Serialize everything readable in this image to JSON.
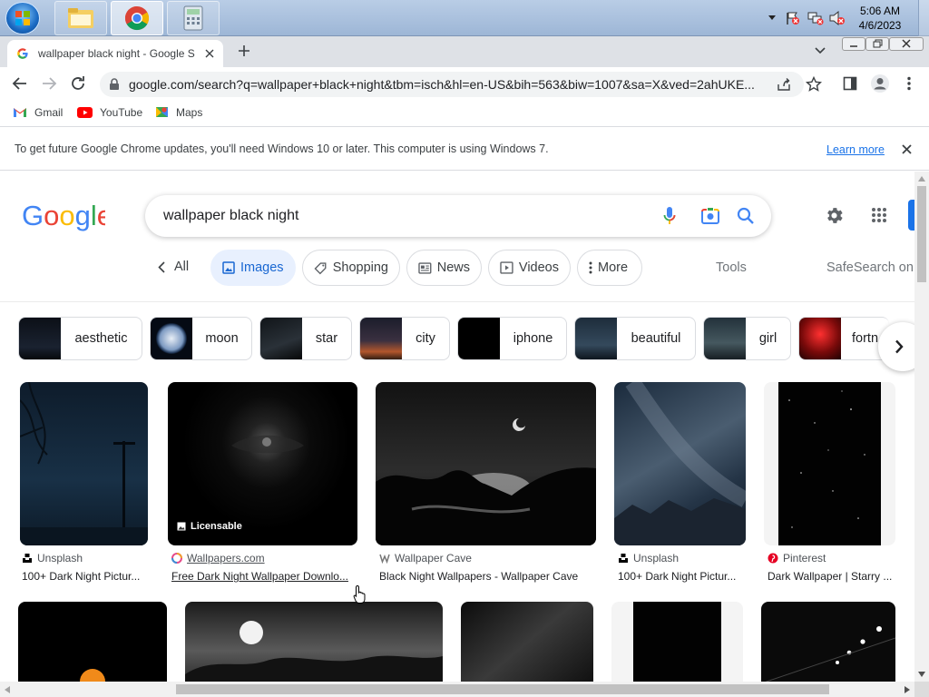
{
  "taskbar": {
    "time": "5:06 AM",
    "date": "4/6/2023"
  },
  "browser": {
    "tab_title": "wallpaper black night - Google S",
    "url": "google.com/search?q=wallpaper+black+night&tbm=isch&hl=en-US&bih=563&biw=1007&sa=X&ved=2ahUKE...",
    "bookmarks": [
      "Gmail",
      "YouTube",
      "Maps"
    ],
    "infobar_text": "To get future Google Chrome updates, you'll need Windows 10 or later. This computer is using Windows 7.",
    "infobar_link": "Learn more"
  },
  "search": {
    "query": "wallpaper black night"
  },
  "nav": {
    "all": "All",
    "images": "Images",
    "shopping": "Shopping",
    "news": "News",
    "videos": "Videos",
    "more": "More",
    "tools": "Tools",
    "safesearch": "SafeSearch on"
  },
  "related": [
    "aesthetic",
    "moon",
    "star",
    "city",
    "iphone",
    "beautiful",
    "girl",
    "fortn"
  ],
  "results": [
    {
      "source": "Unsplash",
      "title": "100+ Dark Night Pictur..."
    },
    {
      "source": "Wallpapers.com",
      "title": "Free Dark Night Wallpaper Downlo...",
      "badge": "Licensable"
    },
    {
      "source": "Wallpaper Cave",
      "title": "Black Night Wallpapers - Wallpaper Cave"
    },
    {
      "source": "Unsplash",
      "title": "100+ Dark Night Pictur..."
    },
    {
      "source": "Pinterest",
      "title": "Dark Wallpaper | Starry ..."
    }
  ],
  "colors": {
    "google_blue": "#4285f4",
    "google_red": "#ea4335",
    "google_yellow": "#fbbc05",
    "google_green": "#34a853",
    "selected_chip": "#e8f0fe"
  }
}
